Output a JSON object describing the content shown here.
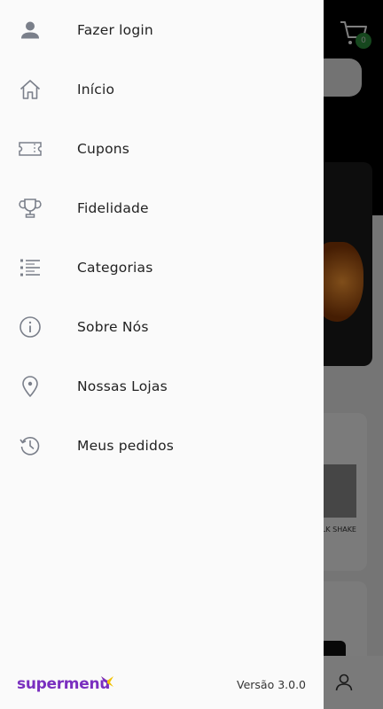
{
  "background": {
    "cart_count": "0",
    "product_label": "LK SHAKE"
  },
  "drawer": {
    "items": [
      {
        "label": "Fazer login",
        "icon": "user-icon"
      },
      {
        "label": "Início",
        "icon": "home-icon"
      },
      {
        "label": "Cupons",
        "icon": "ticket-icon"
      },
      {
        "label": "Fidelidade",
        "icon": "trophy-icon"
      },
      {
        "label": "Categorias",
        "icon": "list-icon"
      },
      {
        "label": "Sobre Nós",
        "icon": "info-icon"
      },
      {
        "label": "Nossas Lojas",
        "icon": "location-pin-icon"
      },
      {
        "label": "Meus pedidos",
        "icon": "history-icon"
      }
    ],
    "footer": {
      "logo_text": "supermenu",
      "version": "Versão 3.0.0"
    }
  },
  "colors": {
    "brand_purple": "#7a2fbf",
    "brand_yellow": "#f2c200",
    "badge_green": "#2c8f3c",
    "drawer_bg": "#fafafa"
  }
}
